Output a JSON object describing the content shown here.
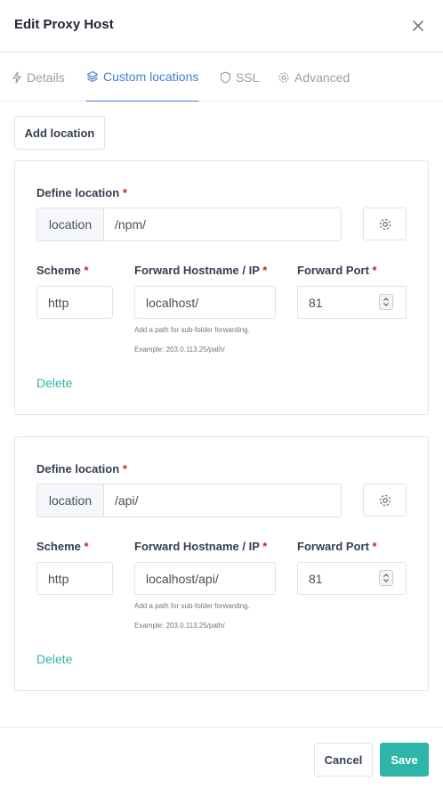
{
  "modal": {
    "title": "Edit Proxy Host"
  },
  "tabs": [
    {
      "label": "Details",
      "icon": "bolt-icon"
    },
    {
      "label": "Custom locations",
      "icon": "layers-icon",
      "active": true
    },
    {
      "label": "SSL",
      "icon": "shield-icon"
    },
    {
      "label": "Advanced",
      "icon": "gear-icon"
    }
  ],
  "add_location_label": "Add location",
  "form_labels": {
    "define_location": "Define location",
    "scheme": "Scheme",
    "forward_hostname": "Forward Hostname / IP",
    "forward_port": "Forward Port",
    "required_marker": "*",
    "location_addon": "location",
    "hint_line1": "Add a path for sub-folder forwarding.",
    "hint_line2": "Example: 203.0.113.25/path/",
    "delete_label": "Delete"
  },
  "locations": [
    {
      "path": "/npm/",
      "scheme": "http",
      "hostname": "localhost/",
      "port": "81"
    },
    {
      "path": "/api/",
      "scheme": "http",
      "hostname": "localhost/api/",
      "port": "81"
    }
  ],
  "footer": {
    "cancel_label": "Cancel",
    "save_label": "Save"
  },
  "colors": {
    "accent": "#467fcf",
    "teal": "#2fb5a8",
    "required": "#cd201f"
  }
}
